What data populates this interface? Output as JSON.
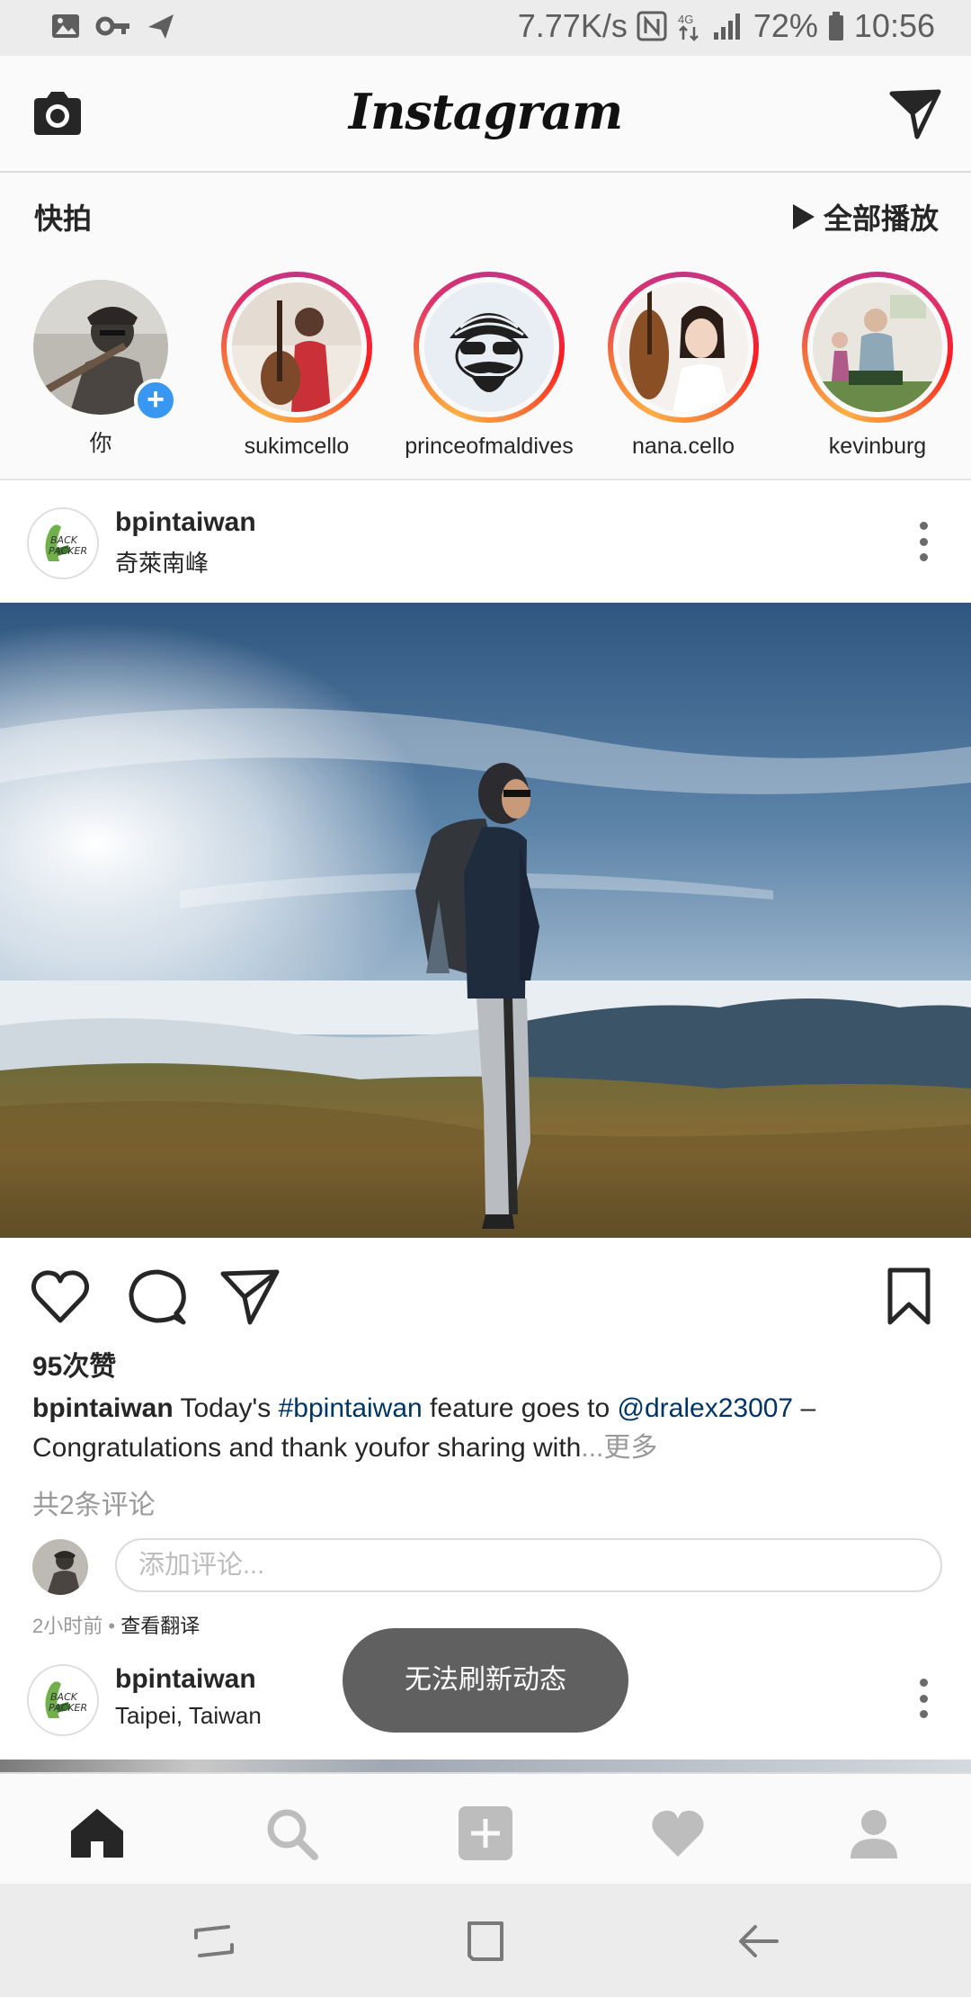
{
  "status_bar": {
    "network_speed": "7.77K/s",
    "signal_type": "4G",
    "battery": "72%",
    "time": "10:56",
    "left_icons": [
      "image-icon",
      "key-icon",
      "send-icon"
    ],
    "right_icons": [
      "nfc-icon",
      "data-arrows-icon",
      "signal-icon",
      "battery-icon"
    ]
  },
  "app_bar": {
    "logo": "Instagram",
    "left_icon": "camera-icon",
    "right_icon": "direct-message-icon"
  },
  "stories": {
    "title": "快拍",
    "watch_all": "全部播放",
    "items": [
      {
        "label": "你",
        "own": true
      },
      {
        "label": "sukimcello"
      },
      {
        "label": "princeofmaldives"
      },
      {
        "label": "nana.cello"
      },
      {
        "label": "kevinburg"
      }
    ]
  },
  "post": {
    "username": "bpintaiwan",
    "location": "奇萊南峰",
    "likes": "95次赞",
    "caption": {
      "user": "bpintaiwan",
      "text1": " Today's ",
      "hashtag": "#bpintaiwan",
      "text2": " feature goes to ",
      "mention": "@dralex23007",
      "text3": " – Congratulations and thank youfor sharing with",
      "ellipsis": "...",
      "more": "更多"
    },
    "comments_count": "共2条评论",
    "comment_placeholder": "添加评论...",
    "time_ago": "2小时前",
    "separator": " • ",
    "translate": "查看翻译"
  },
  "next_post": {
    "username": "bpintaiwan",
    "location": "Taipei, Taiwan"
  },
  "toast": "无法刷新动态",
  "colors": {
    "link": "#003569",
    "muted": "#999999",
    "badge_blue": "#3897f0",
    "toast_bg": "#606060"
  }
}
